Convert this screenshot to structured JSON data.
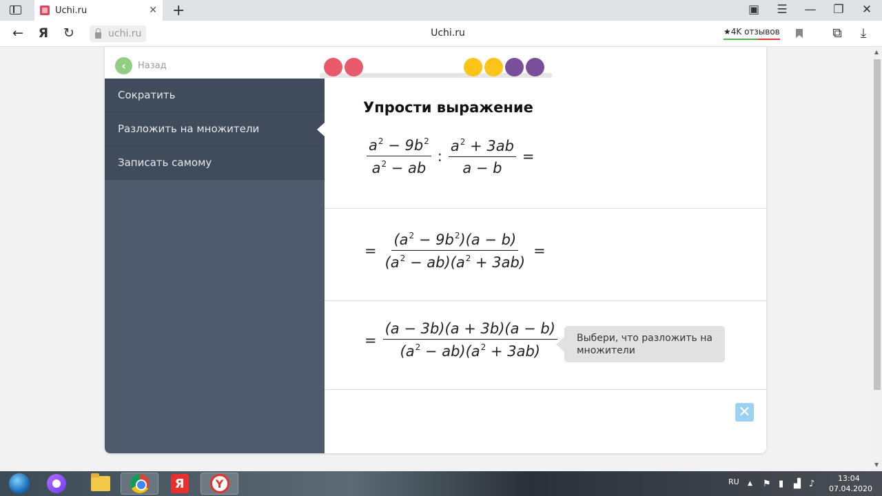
{
  "browser": {
    "tab_title": "Uchi.ru",
    "tab_close": "✕",
    "new_tab": "+",
    "url": "uchi.ru",
    "page_title": "Uchi.ru",
    "reviews": "★4K отзывов",
    "icons": {
      "back": "←",
      "yandex": "Я",
      "reload": "↻",
      "collections": "▣",
      "menu": "☰",
      "minimize": "—",
      "restore": "❐",
      "close": "✕",
      "translate": "⧉",
      "download": "⤓"
    }
  },
  "app": {
    "back_label": "Назад",
    "back_icon": "‹",
    "progress_dots": [
      {
        "color": "#e8596b"
      },
      {
        "color": "#e8596b"
      },
      {
        "color": "#fcc419"
      },
      {
        "color": "#fcc419"
      },
      {
        "color": "#7a4f9a"
      },
      {
        "color": "#7a4f9a"
      }
    ],
    "menu": [
      {
        "label": "Сократить",
        "active": false
      },
      {
        "label": "Разложить на множители",
        "active": true
      },
      {
        "label": "Записать самому",
        "active": false
      }
    ],
    "task_title": "Упрости выражение",
    "step1": {
      "frac1_num_a": "a",
      "frac1_num_exp1": "2",
      "frac1_num_mid": " − 9b",
      "frac1_num_exp2": "2",
      "frac1_den_a": "a",
      "frac1_den_exp": "2",
      "frac1_den_rest": " − ab",
      "colon": ":",
      "frac2_num_a": "a",
      "frac2_num_exp": "2",
      "frac2_num_rest": " + 3ab",
      "frac2_den": "a − b",
      "equals": "="
    },
    "step2": {
      "lead": "=",
      "num_p1": "(a",
      "num_exp1": "2",
      "num_p2": " − 9b",
      "num_exp2": "2",
      "num_p3": ")(a − b)",
      "den_p1": "(a",
      "den_exp1": "2",
      "den_p2": " − ab)(a",
      "den_exp2": "2",
      "den_p3": " + 3ab)",
      "trail": "="
    },
    "step3": {
      "lead": "=",
      "num": "(a − 3b)(a + 3b)(a − b)",
      "den_p1": "(a",
      "den_exp1": "2",
      "den_p2": " − ab)(a",
      "den_exp2": "2",
      "den_p3": " + 3ab)"
    },
    "hint": "Выбери, что разложить на множители",
    "close_icon": "✕",
    "colors": {
      "sidebar": "#4d5b6d",
      "menu_item": "#404c5b",
      "back_green": "#8fce83",
      "close_blue": "#9ad2f0"
    }
  },
  "taskbar": {
    "lang": "RU",
    "time": "13:04",
    "date": "07.04.2020",
    "yandex_letter": "Я",
    "ybrowser_letter": "Y"
  }
}
